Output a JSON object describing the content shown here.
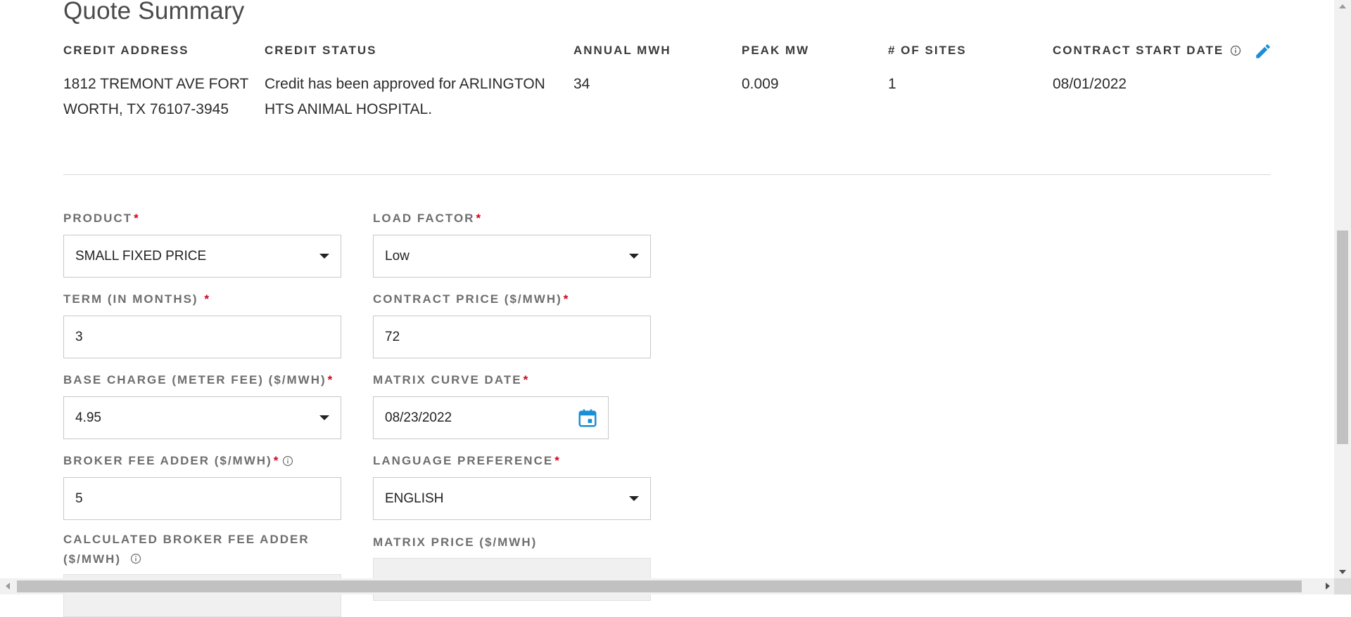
{
  "summary": {
    "title": "Quote Summary",
    "credit_address": {
      "label": "CREDIT ADDRESS",
      "value": "1812 TREMONT AVE FORT WORTH, TX 76107-3945"
    },
    "credit_status": {
      "label": "CREDIT STATUS",
      "value": "Credit has been approved for ARLINGTON HTS ANIMAL HOSPITAL."
    },
    "annual_mwh": {
      "label": "ANNUAL MWH",
      "value": "34"
    },
    "peak_mw": {
      "label": "PEAK MW",
      "value": "0.009"
    },
    "num_sites": {
      "label": "# OF SITES",
      "value": "1"
    },
    "contract_start": {
      "label": "CONTRACT START DATE",
      "value": "08/01/2022"
    }
  },
  "form": {
    "required_mark": "*",
    "product": {
      "label": "PRODUCT",
      "value": "SMALL FIXED PRICE"
    },
    "load_factor": {
      "label": "LOAD FACTOR",
      "value": "Low"
    },
    "term": {
      "label": "TERM (IN MONTHS) ",
      "value": "3"
    },
    "contract_price": {
      "label": "CONTRACT PRICE ($/MWH)",
      "value": "72"
    },
    "base_charge": {
      "label": "BASE CHARGE (METER FEE) ($/MWH)",
      "value": "4.95"
    },
    "matrix_curve_date": {
      "label": "MATRIX CURVE DATE",
      "value": "08/23/2022"
    },
    "broker_fee": {
      "label": "BROKER FEE ADDER ($/MWH)",
      "value": "5"
    },
    "language": {
      "label": "LANGUAGE PREFERENCE",
      "value": "ENGLISH"
    },
    "calc_broker_fee": {
      "label": "CALCULATED BROKER FEE ADDER ($/MWH)",
      "value": ""
    },
    "matrix_price": {
      "label": "MATRIX PRICE ($/MWH)",
      "value": ""
    }
  },
  "colors": {
    "required": "#d0021b",
    "accent": "#1a8fd6"
  },
  "icons": [
    "info-icon",
    "pencil-icon",
    "calendar-icon",
    "chevron-down-icon"
  ]
}
